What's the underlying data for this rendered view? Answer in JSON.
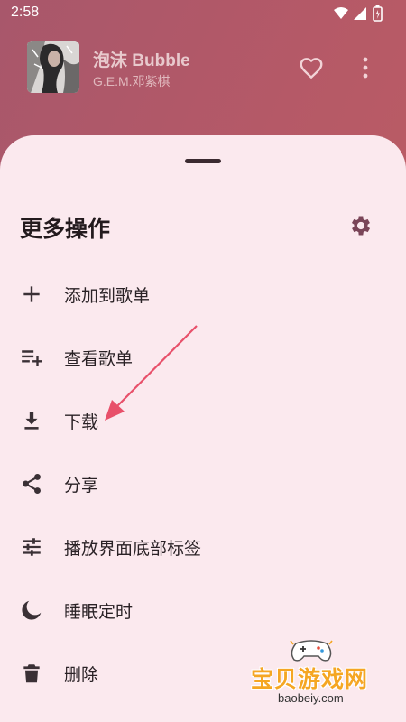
{
  "status_bar": {
    "time": "2:58",
    "icons": [
      "wifi-icon",
      "signal-icon",
      "battery-icon"
    ]
  },
  "now_playing": {
    "title": "泡沫 Bubble",
    "artist": "G.E.M.邓紫棋",
    "favorite_icon": "heart-outline-icon",
    "more_icon": "more-vertical-icon"
  },
  "sheet": {
    "title": "更多操作",
    "settings_icon": "gear-icon",
    "items": [
      {
        "label": "添加到歌单",
        "icon": "plus-icon"
      },
      {
        "label": "查看歌单",
        "icon": "playlist-add-icon"
      },
      {
        "label": "下载",
        "icon": "download-icon"
      },
      {
        "label": "分享",
        "icon": "share-icon"
      },
      {
        "label": "播放界面底部标签",
        "icon": "tune-icon"
      },
      {
        "label": "睡眠定时",
        "icon": "moon-icon"
      },
      {
        "label": "删除",
        "icon": "trash-icon"
      }
    ]
  },
  "watermark": {
    "text": "宝贝游戏网",
    "url": "baobeiy.com"
  },
  "colors": {
    "header_gradient_start": "#a8576b",
    "header_gradient_end": "#c05f61",
    "sheet_background": "#fbe9ee",
    "icon_color": "#3a3035",
    "settings_icon_color": "#7a4558",
    "annotation_arrow": "#e8506a",
    "watermark_text": "#f5a623"
  }
}
